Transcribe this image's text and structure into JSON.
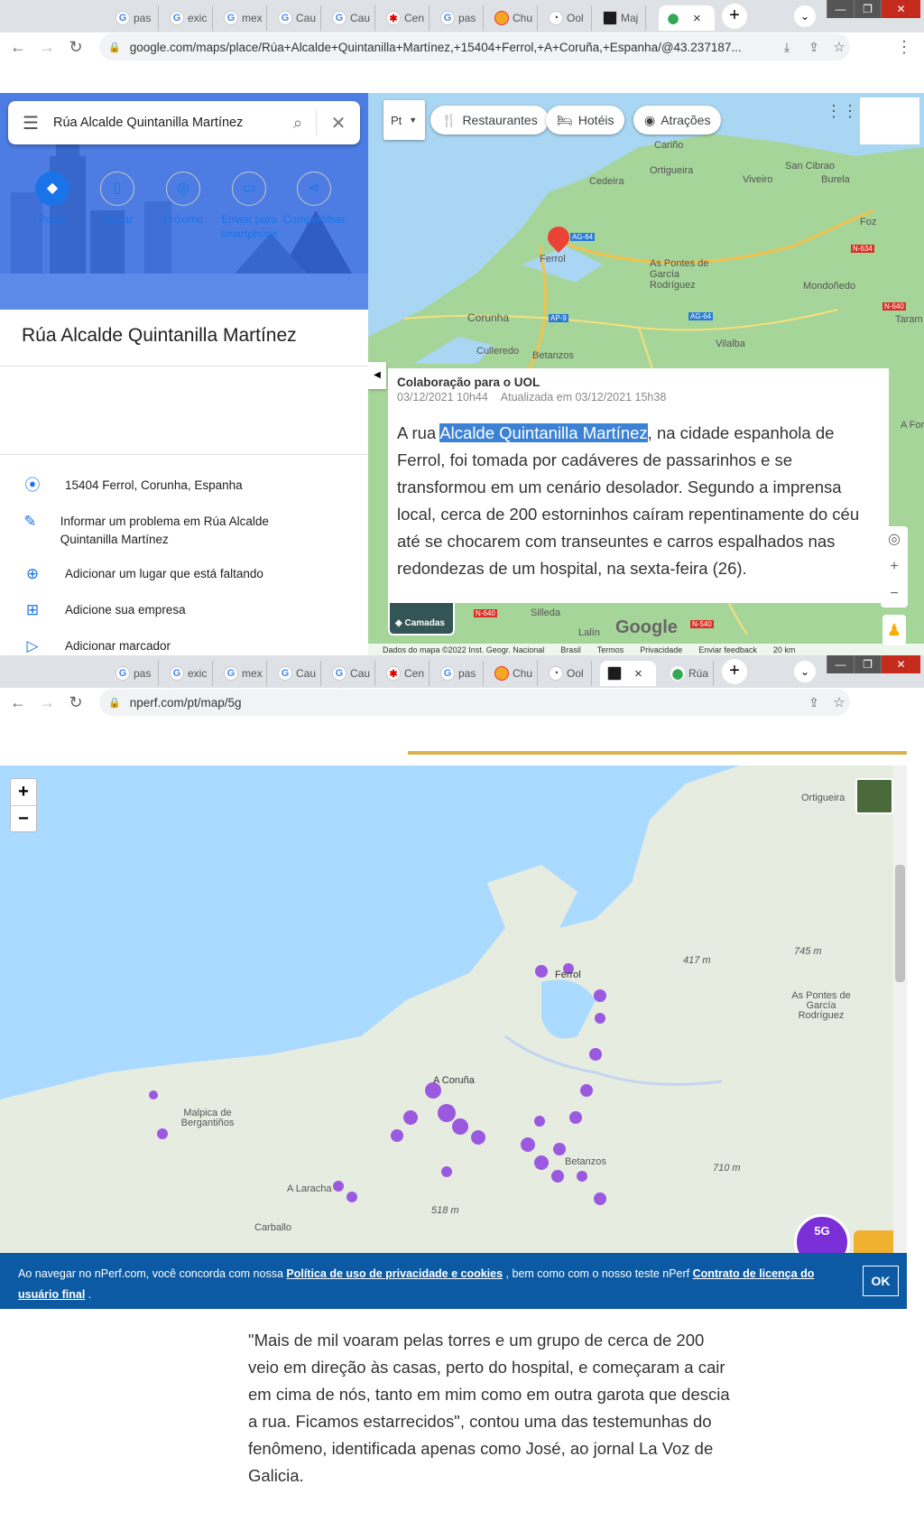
{
  "browser1": {
    "tabs": [
      "pas",
      "exic",
      "mex",
      "Cau",
      "Cau",
      "Cen",
      "pas",
      "Chu",
      "Ool",
      "Maj",
      ""
    ],
    "url": "google.com/maps/place/Rúa+Alcalde+Quintanilla+Martínez,+15404+Ferrol,+A+Coruña,+Espanha/@43.237187..."
  },
  "maps_panel": {
    "search_value": "Rúa Alcalde Quintanilla Martínez",
    "place_title": "Rúa Alcalde Quintanilla Martínez",
    "actions": [
      "Rotas",
      "Salvar",
      "Próximo",
      "Enviar para smartphone",
      "Compartilhar"
    ],
    "address": "15404 Ferrol, Corunha, Espanha",
    "report": "Informar um problema em Rúa Alcalde Quintanilla Martínez",
    "add_place": "Adicionar um lugar que está faltando",
    "add_business": "Adicione sua empresa",
    "add_label": "Adicionar marcador"
  },
  "map_toolbar": {
    "lang": "Pt",
    "chips": [
      "Restaurantes",
      "Hotéis",
      "Atrações"
    ]
  },
  "map_labels": [
    "Cariño",
    "Ortigueira",
    "Cedeira",
    "Viveiro",
    "San Cibrao",
    "Burela",
    "Foz",
    "Ferrol",
    "As Pontes de García Rodríguez",
    "Mondoñedo",
    "Corunha",
    "Culleredo",
    "Betanzos",
    "Vilalba",
    "Silleda",
    "Lalín",
    "Taram",
    "A Fon"
  ],
  "road_labels": [
    "AG-64",
    "AG-64",
    "N-634",
    "AP-9",
    "N-640",
    "N-640",
    "N-540"
  ],
  "map_footer": [
    "Dados do mapa ©2022 Inst. Geogr. Nacional",
    "Brasil",
    "Termos",
    "Privacidade",
    "Enviar feedback",
    "20 km"
  ],
  "layers_label": "Camadas",
  "google_logo": "Google",
  "article": {
    "byline": "Colaboração para o UOL",
    "date": "03/12/2021  10h44",
    "updated": "Atualizada em 03/12/2021  15h38",
    "text_before": "A rua ",
    "highlight": "Alcalde Quintanilla Martínez",
    "text_after": ", na cidade espanhola de Ferrol, foi tomada por cadáveres de passarinhos e se transformou em um cenário desolador. Segundo a imprensa local, cerca de 200 estorninhos caíram repentinamente do céu até se chocarem com transeuntes e carros espalhados nas redondezas de um hospital, na sexta-feira (26)."
  },
  "browser2": {
    "tabs": [
      "pas",
      "exic",
      "mex",
      "Cau",
      "Cau",
      "Cen",
      "pas",
      "Chu",
      "Ool",
      "",
      "Rúa"
    ],
    "url": "nperf.com/pt/map/5g"
  },
  "nperf_labels": [
    "Ortigueira",
    "417 m",
    "745 m",
    "Ferrol",
    "As Pontes de García Rodríguez",
    "A Coruña",
    "Malpica de Bergantiños",
    "Betanzos",
    "710 m",
    "A Laracha",
    "518 m",
    "Carballo"
  ],
  "nperf_badge": "5G",
  "cookie": {
    "t1": "Ao navegar no nPerf.com, você concorda com nossa ",
    "link1": "Política de uso de privacidade e cookies",
    "t2": " , bem como com o nosso teste nPerf ",
    "link2": "Contrato de licença do usuário final",
    "t3": " .",
    "ok": "OK"
  },
  "quote": "\"Mais de mil voaram pelas torres e um grupo de cerca de 200 veio em direção às casas, perto do hospital, e começaram a cair em cima de nós, tanto em mim como em outra garota que descia a rua. Ficamos estarrecidos\", contou uma das testemunhas do fenômeno, identificada apenas como José, ao jornal La Voz de Galicia."
}
